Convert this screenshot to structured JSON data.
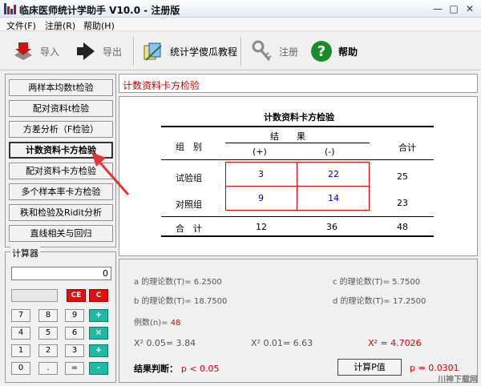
{
  "window": {
    "title": "临床医师统计学助手 V10.0 - 注册版",
    "controls": [
      "—",
      "□",
      "✕"
    ]
  },
  "menu": [
    "文件(F)",
    "注册(R)",
    "帮助(H)"
  ],
  "toolbar": {
    "import_label": "导入",
    "export_label": "导出",
    "tutorial_label": "统计学傻瓜教程",
    "register_label": "注册",
    "help_label": "帮助"
  },
  "nav": [
    "两样本均数t检验",
    "配对资料t检验",
    "方差分析（F检验）",
    "计数资料卡方检验",
    "配对资料卡方检验",
    "多个样本率卡方检验",
    "秩和检验及Ridit分析",
    "直线相关与回归"
  ],
  "calculator": {
    "title": "计算器",
    "display": "0",
    "keys": [
      [
        "CE",
        "C"
      ],
      [
        "7",
        "8",
        "9",
        "+"
      ],
      [
        "4",
        "5",
        "6",
        "×"
      ],
      [
        "1",
        "2",
        "3",
        "+"
      ],
      [
        "0",
        ".",
        "=",
        "-"
      ]
    ]
  },
  "panel_title": "计数资料卡方检验",
  "table": {
    "title": "计数资料卡方检验",
    "col_group": "组　别",
    "result_header": "结　　果",
    "pos_header": "(+)",
    "neg_header": "(-)",
    "total_header": "合计",
    "rows": [
      {
        "label": "试验组",
        "pos": "3",
        "neg": "22",
        "total": "25"
      },
      {
        "label": "对照组",
        "pos": "9",
        "neg": "14",
        "total": "23"
      }
    ],
    "total_row": {
      "label": "合　计",
      "pos": "12",
      "neg": "36",
      "total": "48"
    }
  },
  "stats": {
    "a_label": "a 的理论数(T)=",
    "a_value": "6.2500",
    "b_label": "b 的理论数(T)=",
    "b_value": "18.7500",
    "c_label": "c 的理论数(T)=",
    "c_value": "5.7500",
    "d_label": "d 的理论数(T)=",
    "d_value": "17.2500",
    "n_label": "例数(n)=",
    "n_value": "48",
    "chi_05_label": "X² 0.05= 3.84",
    "chi_01_label": "X² 0.01= 6.63",
    "chi_label": "X² =",
    "chi_value": "4.7026",
    "conclusion_label": "结果判断：",
    "conclusion_value": "p < 0.05",
    "calc_p_button": "计算P值",
    "p_value": "p = 0.0301"
  },
  "watermark": "川神下载网"
}
